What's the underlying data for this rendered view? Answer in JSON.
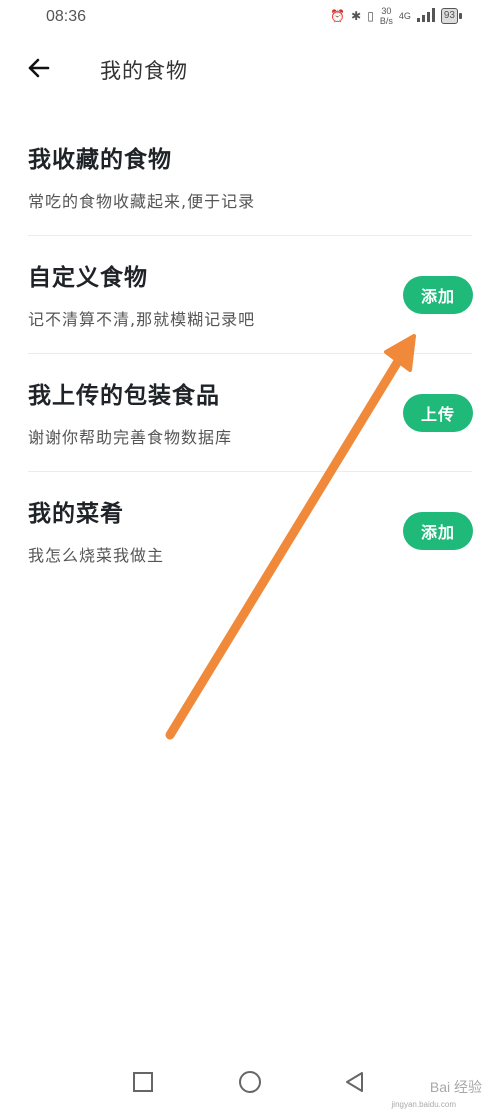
{
  "status_bar": {
    "time": "08:36",
    "speed_value": "30",
    "speed_unit": "B/s",
    "network": "4G",
    "battery": "93"
  },
  "header": {
    "back_icon": "arrow-left-icon",
    "title": "我的食物"
  },
  "items": [
    {
      "title": "我收藏的食物",
      "subtitle": "常吃的食物收藏起来,便于记录"
    },
    {
      "title": "自定义食物",
      "subtitle": "记不清算不清,那就模糊记录吧",
      "button": "添加"
    },
    {
      "title": "我上传的包装食品",
      "subtitle": "谢谢你帮助完善食物数据库",
      "button": "上传"
    },
    {
      "title": "我的菜肴",
      "subtitle": "我怎么烧菜我做主",
      "button": "添加"
    }
  ],
  "colors": {
    "accent": "#1fb97a",
    "arrow": "#f0893a"
  },
  "nav": {
    "square_icon": "recents-square-icon",
    "circle_icon": "home-circle-icon",
    "triangle_icon": "back-triangle-icon"
  },
  "watermark": {
    "text": "Bai 经验",
    "sub": "jingyan.baidu.com"
  }
}
